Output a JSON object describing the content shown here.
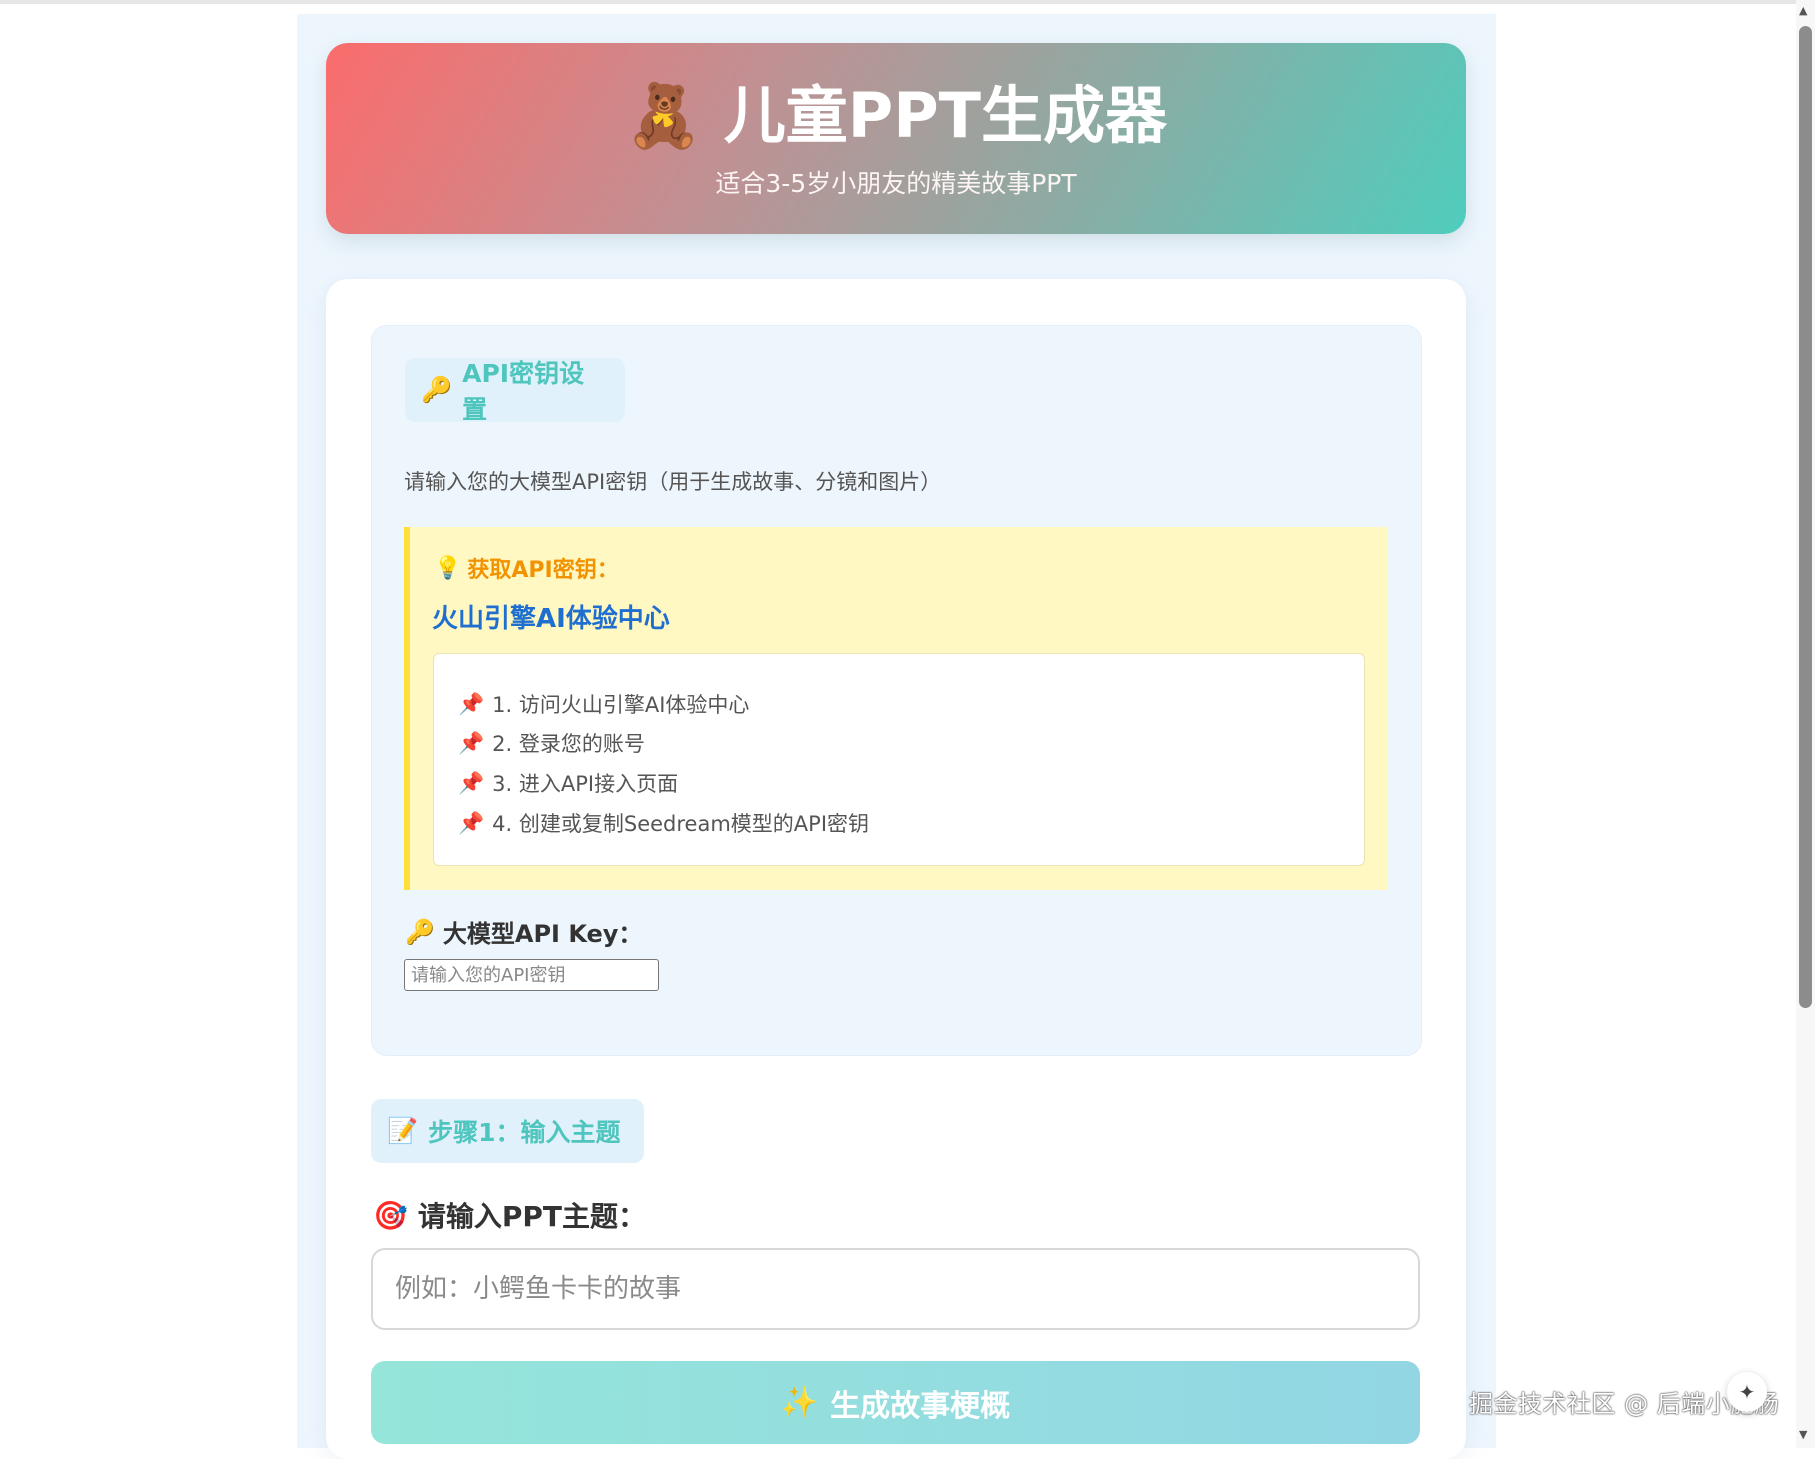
{
  "header": {
    "icon": "teddy-bear-icon",
    "icon_glyph": "🧸",
    "title": "儿童PPT生成器",
    "subtitle": "适合3-5岁小朋友的精美故事PPT"
  },
  "api_section": {
    "tag_icon": "key-icon",
    "tag_glyph": "🔑",
    "tag_label": "API密钥设置",
    "description": "请输入您的大模型API密钥（用于生成故事、分镜和图片）",
    "tip": {
      "icon": "lightbulb-icon",
      "icon_glyph": "💡",
      "title": "获取API密钥：",
      "link_text": "火山引擎AI体验中心",
      "steps": [
        {
          "glyph": "📌",
          "text": "1. 访问火山引擎AI体验中心"
        },
        {
          "glyph": "📌",
          "text": "2. 登录您的账号"
        },
        {
          "glyph": "📌",
          "text": "3. 进入API接入页面"
        },
        {
          "glyph": "📌",
          "text": "4. 创建或复制Seedream模型的API密钥"
        }
      ]
    },
    "key_label_glyph": "🔑",
    "key_label": "大模型API Key：",
    "key_placeholder": "请输入您的API密钥"
  },
  "step1": {
    "tag_icon": "memo-icon",
    "tag_glyph": "📝",
    "tag_label": "步骤1：输入主题",
    "topic_label_glyph": "🎯",
    "topic_label": "请输入PPT主题：",
    "topic_placeholder": "例如：小鳄鱼卡卡的故事",
    "generate_glyph": "✨",
    "generate_label": "生成故事梗概"
  },
  "watermark": "掘金技术社区 @ 后端小肥肠",
  "colors": {
    "accent_teal": "#4ec5bd",
    "tip_title": "#f39200",
    "link_blue": "#1f6fd1",
    "tip_border": "#ffe03a"
  }
}
